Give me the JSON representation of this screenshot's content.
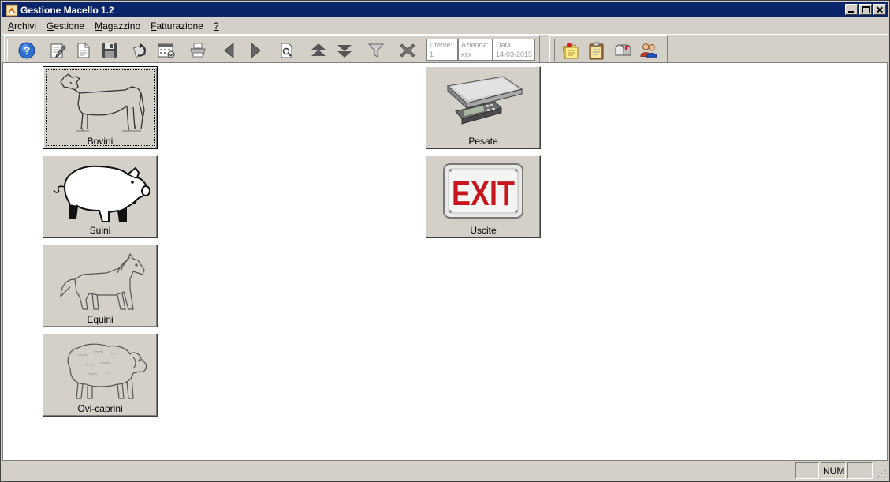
{
  "window": {
    "title": "Gestione Macello 1.2"
  },
  "menu": [
    {
      "label": "Archivi",
      "accel": "A",
      "rest": "rchivi"
    },
    {
      "label": "Gestione",
      "accel": "G",
      "rest": "estione"
    },
    {
      "label": "Magazzino",
      "accel": "M",
      "rest": "agazzino"
    },
    {
      "label": "Fatturazione",
      "accel": "F",
      "rest": "atturazione"
    },
    {
      "label": "?",
      "accel": "?",
      "rest": ""
    }
  ],
  "toolbar": {
    "buttons": [
      "help-icon",
      "edit-icon",
      "new-document-icon",
      "save-icon",
      "refresh-icon",
      "calendar-icon",
      "print-icon",
      "previous-icon",
      "next-icon",
      "preview-icon",
      "move-up-icon",
      "move-down-icon",
      "filter-icon",
      "delete-icon"
    ],
    "info": {
      "utente_label": "Utente:",
      "utente_value": "1",
      "azienda_label": "Azienda:",
      "azienda_value": "xxx",
      "data_label": "Data:",
      "data_value": "14-03-2015"
    },
    "right_buttons": [
      "notes-icon",
      "clipboard-icon",
      "mailbox-icon",
      "users-icon"
    ]
  },
  "tiles": {
    "bovini": {
      "label": "Bovini",
      "icon": "cow-icon"
    },
    "suini": {
      "label": "Suini",
      "icon": "pig-icon"
    },
    "equini": {
      "label": "Equini",
      "icon": "horse-icon"
    },
    "ovicaprini": {
      "label": "Ovi-caprini",
      "icon": "sheep-icon"
    },
    "pesate": {
      "label": "Pesate",
      "icon": "scale-icon"
    },
    "uscite": {
      "label": "Uscite",
      "icon": "exit-sign-icon",
      "sign_text": "EXIT"
    }
  },
  "status": {
    "num": "NUM"
  },
  "colors": {
    "titlebar": "#0a246a",
    "face": "#d4d0c8",
    "exit_red": "#c8161e"
  }
}
